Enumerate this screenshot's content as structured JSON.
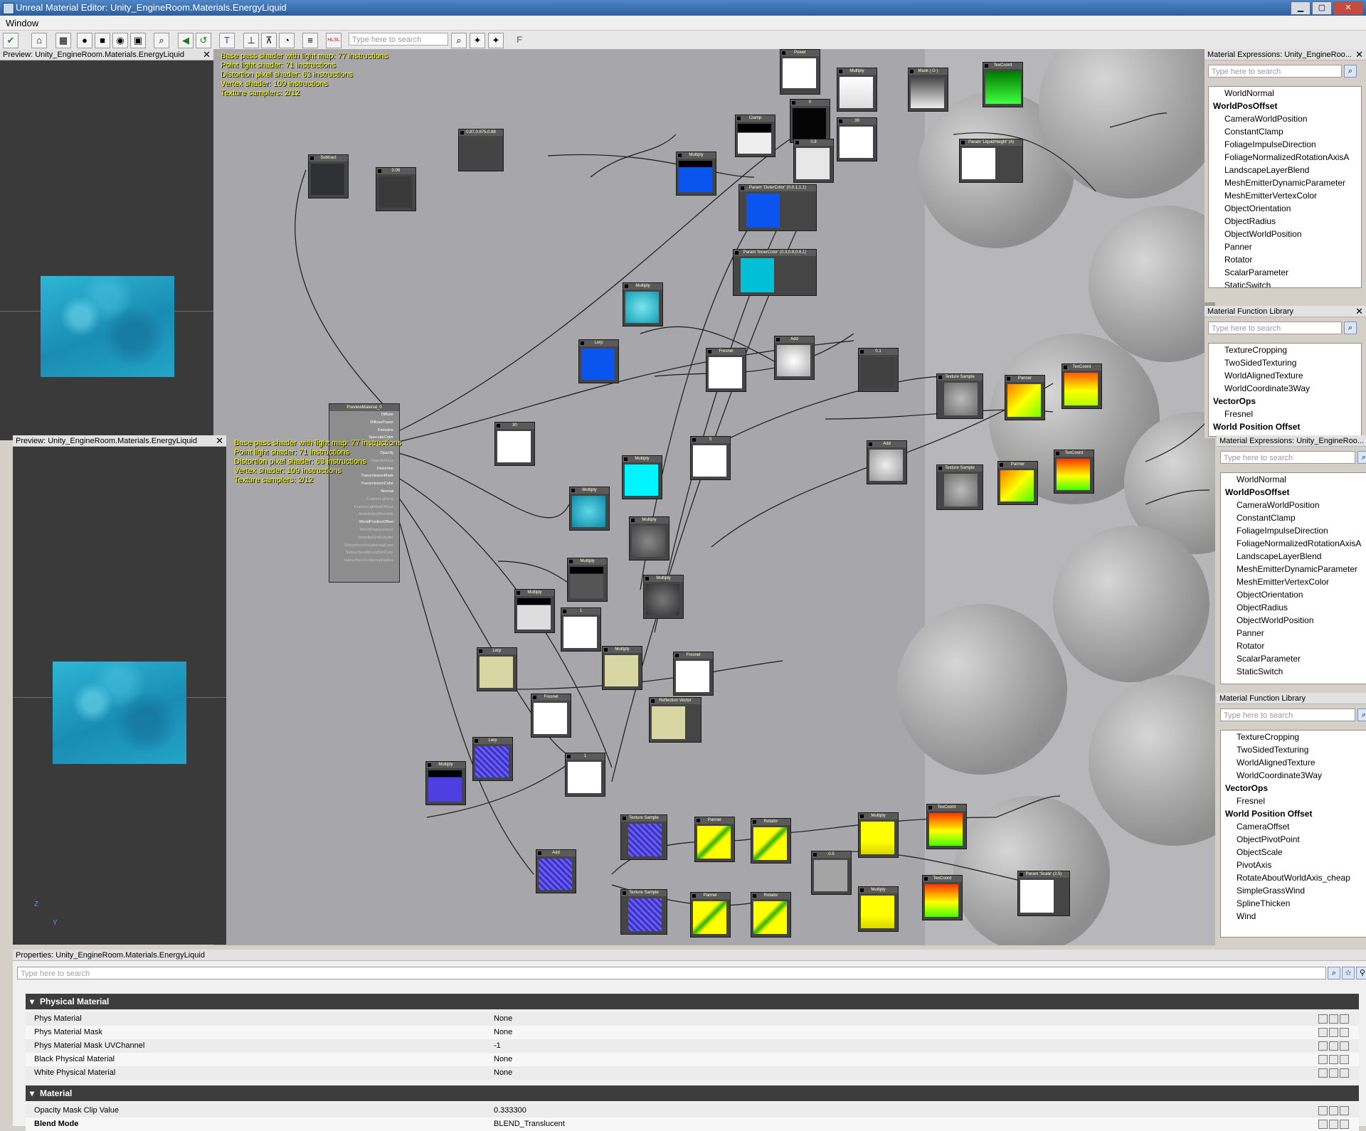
{
  "window": {
    "title": "Unreal Material Editor: Unity_EngineRoom.Materials.EnergyLiquid",
    "menu": "Window"
  },
  "toolbar": {
    "search_placeholder": "Type here to search",
    "hlsl_label": "HLSL",
    "f_label": "F"
  },
  "preview": {
    "title": "Preview: Unity_EngineRoom.Materials.EnergyLiquid",
    "axis_z": "Z",
    "axis_y": "Y"
  },
  "stats": {
    "lines": [
      "Base pass shader with light map: 77 instructions",
      "Point light shader: 71 instructions",
      "Distortion pixel shader: 63 instructions",
      "Vertex shader: 109 instructions",
      "Texture samplers: 2/12"
    ]
  },
  "nodes": {
    "power": "Power",
    "multiply": "Multiply",
    "mask": "Mask ( G )",
    "texcoord": "TexCoord",
    "clamp": "Clamp",
    "zero": "0",
    "eight": "0.8",
    "thirtynine": "39",
    "liquidheight": "Param 'LiquidHeight' (4)",
    "const3": "0.87,0.875,0.88",
    "subtract": "Subtract",
    "c006": "0.06",
    "outercolor": "Param 'OuterColor' (0,0.1,1,1)",
    "innercolor": "Param 'InnerColor' (0.3,0.8,0.6,1)",
    "lerp": "Lerp",
    "fresnel": "Fresnel",
    "add": "Add",
    "c01": "0.1",
    "texsample": "Texture Sample",
    "panner": "Panner",
    "c30": "30",
    "c5": "5",
    "c1": "1",
    "c05": "0.5",
    "reflvec": "Reflection Vector",
    "rotator": "Rotator",
    "scale": "Param 'Scale' (2.5)"
  },
  "main_node": {
    "title": "PreviewMaterial_0",
    "inputs": [
      {
        "label": "Diffuse",
        "active": true
      },
      {
        "label": "DiffusePower",
        "active": true
      },
      {
        "label": "Emissive",
        "active": true
      },
      {
        "label": "SpecularColor",
        "active": true
      },
      {
        "label": "SpecularPower",
        "active": true
      },
      {
        "label": "Opacity",
        "active": true
      },
      {
        "label": "OpacityMask",
        "active": false
      },
      {
        "label": "Distortion",
        "active": true
      },
      {
        "label": "TransmissionMask",
        "active": true
      },
      {
        "label": "TransmissionColor",
        "active": true
      },
      {
        "label": "Normal",
        "active": true
      },
      {
        "label": "CustomLighting",
        "active": false
      },
      {
        "label": "CustomLightingDiffuse",
        "active": false
      },
      {
        "label": "AnisotropicDirection",
        "active": false
      },
      {
        "label": "WorldPositionOffset",
        "active": true
      },
      {
        "label": "WorldDisplacement",
        "active": false
      },
      {
        "label": "TessellationMultiplier",
        "active": false
      },
      {
        "label": "SubsurfaceInscatteringColor",
        "active": false
      },
      {
        "label": "SubsurfaceAbsorptionColor",
        "active": false
      },
      {
        "label": "SubsurfaceScatteringRadius",
        "active": false
      }
    ]
  },
  "expressions": {
    "title": "Material Expressions: Unity_EngineRoo...",
    "search_placeholder": "Type here to search",
    "items": [
      {
        "label": "WorldNormal",
        "type": "sub"
      },
      {
        "label": "WorldPosOffset",
        "type": "cat"
      },
      {
        "label": "CameraWorldPosition",
        "type": "sub"
      },
      {
        "label": "ConstantClamp",
        "type": "sub"
      },
      {
        "label": "FoliageImpulseDirection",
        "type": "sub"
      },
      {
        "label": "FoliageNormalizedRotationAxisA",
        "type": "sub"
      },
      {
        "label": "LandscapeLayerBlend",
        "type": "sub"
      },
      {
        "label": "MeshEmitterDynamicParameter",
        "type": "sub"
      },
      {
        "label": "MeshEmitterVertexColor",
        "type": "sub"
      },
      {
        "label": "ObjectOrientation",
        "type": "sub"
      },
      {
        "label": "ObjectRadius",
        "type": "sub"
      },
      {
        "label": "ObjectWorldPosition",
        "type": "sub"
      },
      {
        "label": "Panner",
        "type": "sub"
      },
      {
        "label": "Rotator",
        "type": "sub"
      },
      {
        "label": "ScalarParameter",
        "type": "sub"
      },
      {
        "label": "StaticSwitch",
        "type": "sub"
      }
    ]
  },
  "function_library": {
    "title": "Material Function Library",
    "search_placeholder": "Type here to search",
    "items_top": [
      {
        "label": "TextureCropping",
        "type": "sub"
      },
      {
        "label": "TwoSidedTexturing",
        "type": "sub"
      },
      {
        "label": "WorldAlignedTexture",
        "type": "sub"
      },
      {
        "label": "WorldCoordinate3Way",
        "type": "sub"
      },
      {
        "label": "VectorOps",
        "type": "cat"
      },
      {
        "label": "Fresnel",
        "type": "sub"
      },
      {
        "label": "World Position Offset",
        "type": "cat"
      }
    ],
    "items": [
      {
        "label": "TextureCropping",
        "type": "sub"
      },
      {
        "label": "TwoSidedTexturing",
        "type": "sub"
      },
      {
        "label": "WorldAlignedTexture",
        "type": "sub"
      },
      {
        "label": "WorldCoordinate3Way",
        "type": "sub"
      },
      {
        "label": "VectorOps",
        "type": "cat"
      },
      {
        "label": "Fresnel",
        "type": "sub"
      },
      {
        "label": "World Position Offset",
        "type": "cat"
      },
      {
        "label": "CameraOffset",
        "type": "sub"
      },
      {
        "label": "ObjectPivotPoint",
        "type": "sub"
      },
      {
        "label": "ObjectScale",
        "type": "sub"
      },
      {
        "label": "PivotAxis",
        "type": "sub"
      },
      {
        "label": "RotateAboutWorldAxis_cheap",
        "type": "sub"
      },
      {
        "label": "SimpleGrassWind",
        "type": "sub"
      },
      {
        "label": "SplineThicken",
        "type": "sub"
      },
      {
        "label": "Wind",
        "type": "sub"
      }
    ]
  },
  "properties": {
    "title": "Properties: Unity_EngineRoom.Materials.EnergyLiquid",
    "search_placeholder": "Type here to search",
    "sections": [
      {
        "name": "Physical Material",
        "rows": [
          {
            "name": "Phys Material",
            "value": "None"
          },
          {
            "name": "Phys Material Mask",
            "value": "None"
          },
          {
            "name": "Phys Material Mask UVChannel",
            "value": "-1"
          },
          {
            "name": "Black Physical Material",
            "value": "None"
          },
          {
            "name": "White Physical Material",
            "value": "None"
          }
        ]
      },
      {
        "name": "Material",
        "rows": [
          {
            "name": "Opacity Mask Clip Value",
            "value": "0.333300"
          },
          {
            "name": "Blend Mode",
            "value": "BLEND_Translucent"
          }
        ]
      }
    ]
  }
}
